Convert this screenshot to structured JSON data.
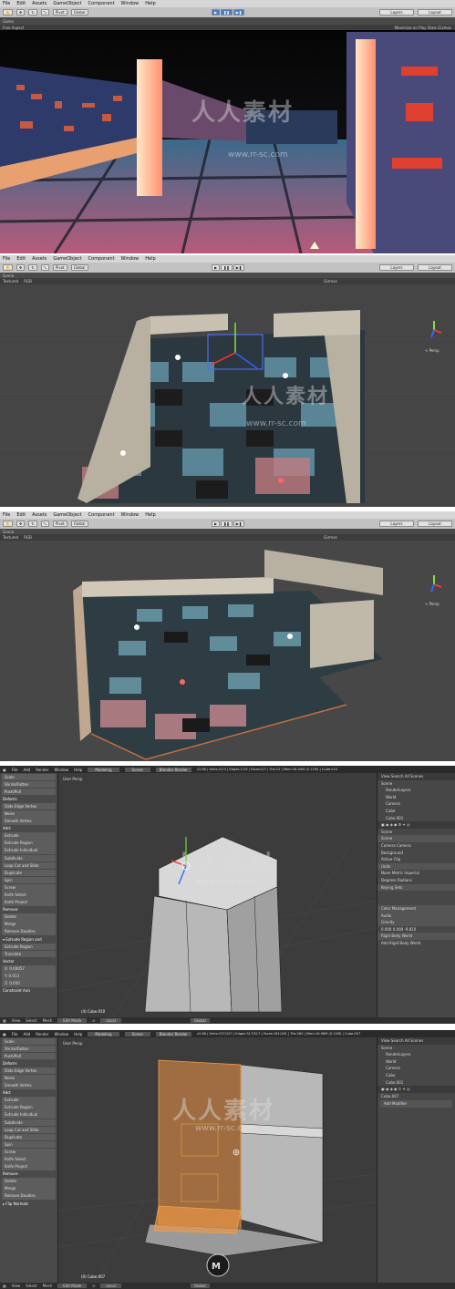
{
  "unity_menu": [
    "File",
    "Edit",
    "Assets",
    "GameObject",
    "Component",
    "Window",
    "Help"
  ],
  "unity_toolbar": {
    "pivot": "Pivot",
    "global": "Global",
    "layers": "Layers",
    "layout": "Layout"
  },
  "game_view": {
    "tab": "Game",
    "aspect": "Free Aspect",
    "options": "Maximize on Play  Stats  Gizmos"
  },
  "scene_view": {
    "tab": "Scene",
    "mode": "Textured",
    "rgb": "RGB",
    "gizmos": "Gizmos",
    "persp": "< Persp"
  },
  "blender_menu": [
    "File",
    "Add",
    "Render",
    "Window",
    "Help"
  ],
  "blender_top": {
    "screen": "Modeling",
    "scene": "Scene",
    "engine": "Blender Render",
    "stats1": "v2.68 | Verts:2/13 | Edges:1/19 | Faces:0/7 | Tris:12 | Mem:16.04M (0.11M) | Cube.010",
    "stats2": "v2.68 | Verts:157/157 | Edges:317/317 | Faces:161/161 | Tris:280 | Mem:16.96M (0.12M) | Cube.007"
  },
  "blender_tools1": [
    "Scale",
    "Shrink/Fatten",
    "Push/Pull",
    "Deform:",
    "Slide Edge   Vertex",
    "Noise",
    "Smooth Vertex",
    "Add:",
    "Extrude",
    "Extrude Region",
    "Extrude Individual",
    "Subdivide",
    "Loop Cut and Slide",
    "Duplicate",
    "Spin",
    "Screw",
    "Knife      Select",
    "Knife Project",
    "Remove:",
    "Delete",
    "Merge",
    "Remove Doubles",
    "▾ Extrude Region and",
    "Extrude Region",
    "Translate",
    "Vector",
    "X: 0.00057",
    "Y: 0.013",
    "Z: 0.050",
    "Constraint Axis"
  ],
  "blender_tools2": [
    "Scale",
    "Shrink/Fatten",
    "Push/Pull",
    "Deform:",
    "Slide Edge   Vertex",
    "Noise",
    "Smooth Vertex",
    "Add:",
    "Extrude",
    "Extrude Region",
    "Extrude Individual",
    "Subdivide",
    "Loop Cut and Slide",
    "Duplicate",
    "Spin",
    "Screw",
    "Knife      Select",
    "Knife Project",
    "Remove:",
    "Delete",
    "Merge",
    "Remove Doubles",
    "▸ Flip Normals"
  ],
  "blender_viewport": {
    "label": "User Persp",
    "obj1": "(4) Cube.010",
    "obj2": "(0) Cube.007"
  },
  "blender_bottom": {
    "items": [
      "View",
      "Select",
      "Mesh",
      "Edit Mode",
      "Local"
    ],
    "global": "Global"
  },
  "outliner1": [
    "View  Search  All Scenes",
    "Scene",
    "RenderLayers",
    "World",
    "Camera",
    "Cube",
    "Cube.001",
    "Scene",
    "Scene",
    "Camera     Camera",
    "Background",
    "Active Clip",
    "Units",
    "None   Metric   Imperial",
    "Degrees      Radians",
    "Keying Sets",
    "Color Management",
    "Audio",
    "Gravity",
    "0.000   0.000   -9.810",
    "Rigid Body World",
    "Add Rigid Body World"
  ],
  "outliner2": [
    "View  Search  All Scenes",
    "Scene",
    "RenderLayers",
    "World",
    "Camera",
    "Cube",
    "Cube.001",
    "Cube.007",
    "Add Modifier"
  ],
  "watermark": {
    "cn": "人人素材",
    "url": "www.rr-sc.com"
  },
  "colors": {
    "unity_bar": "#d6d6d6",
    "blender_dark": "#2a2a2a",
    "selection": "#f0a040"
  }
}
